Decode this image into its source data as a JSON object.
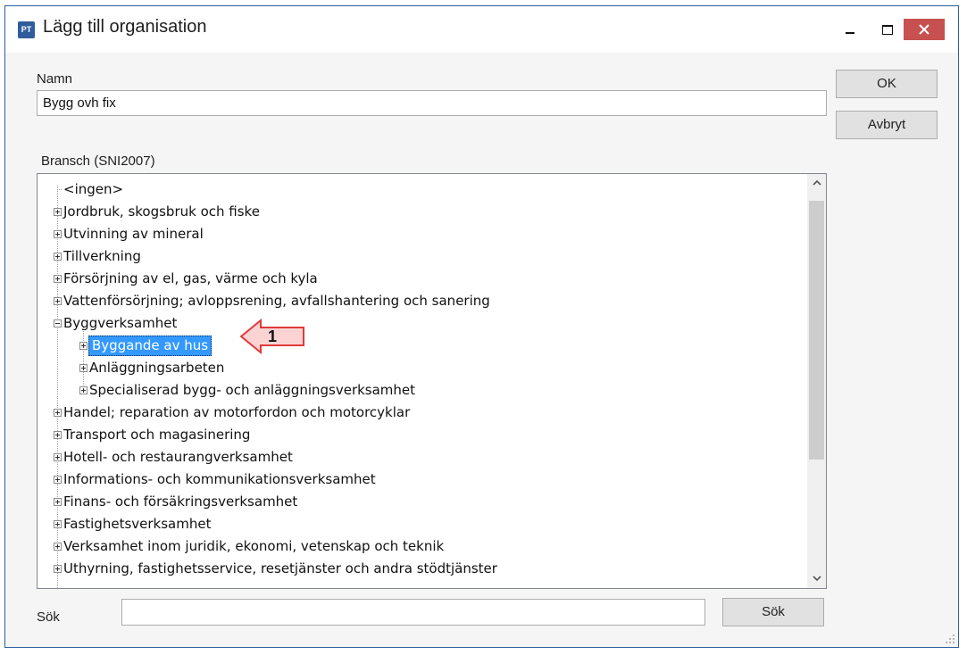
{
  "window": {
    "app_icon_text": "PT",
    "title": "Lägg till organisation",
    "accent": "#2f5d9c",
    "close_color": "#c75050"
  },
  "form": {
    "name_label": "Namn",
    "name_value": "Bygg ovh fix",
    "branch_label": "Bransch (SNI2007)",
    "search_label": "Sök",
    "search_value": ""
  },
  "buttons": {
    "ok": "OK",
    "cancel": "Avbryt",
    "search": "Sök"
  },
  "tree": {
    "items": [
      {
        "label": "<ingen>",
        "level": 0,
        "state": "leaf"
      },
      {
        "label": "Jordbruk, skogsbruk och fiske",
        "level": 0,
        "state": "collapsed"
      },
      {
        "label": "Utvinning av mineral",
        "level": 0,
        "state": "collapsed"
      },
      {
        "label": "Tillverkning",
        "level": 0,
        "state": "collapsed"
      },
      {
        "label": "Försörjning av el, gas, värme och kyla",
        "level": 0,
        "state": "collapsed"
      },
      {
        "label": "Vattenförsörjning; avloppsrening, avfallshantering och sanering",
        "level": 0,
        "state": "collapsed"
      },
      {
        "label": "Byggverksamhet",
        "level": 0,
        "state": "expanded"
      },
      {
        "label": "Byggande av hus",
        "level": 1,
        "state": "collapsed",
        "selected": true
      },
      {
        "label": "Anläggningsarbeten",
        "level": 1,
        "state": "collapsed"
      },
      {
        "label": "Specialiserad bygg- och anläggningsverksamhet",
        "level": 1,
        "state": "collapsed"
      },
      {
        "label": "Handel; reparation av motorfordon och motorcyklar",
        "level": 0,
        "state": "collapsed"
      },
      {
        "label": "Transport och magasinering",
        "level": 0,
        "state": "collapsed"
      },
      {
        "label": "Hotell- och restaurangverksamhet",
        "level": 0,
        "state": "collapsed"
      },
      {
        "label": "Informations- och kommunikationsverksamhet",
        "level": 0,
        "state": "collapsed"
      },
      {
        "label": "Finans- och försäkringsverksamhet",
        "level": 0,
        "state": "collapsed"
      },
      {
        "label": "Fastighetsverksamhet",
        "level": 0,
        "state": "collapsed"
      },
      {
        "label": "Verksamhet inom juridik, ekonomi, vetenskap och teknik",
        "level": 0,
        "state": "collapsed"
      },
      {
        "label": "Uthyrning, fastighetsservice, resetjänster och andra stödtjänster",
        "level": 0,
        "state": "collapsed"
      }
    ],
    "selection_color": "#3399ff"
  },
  "annotation": {
    "number": "1",
    "fill": "#fbd3d3",
    "stroke": "#e03a3a"
  }
}
